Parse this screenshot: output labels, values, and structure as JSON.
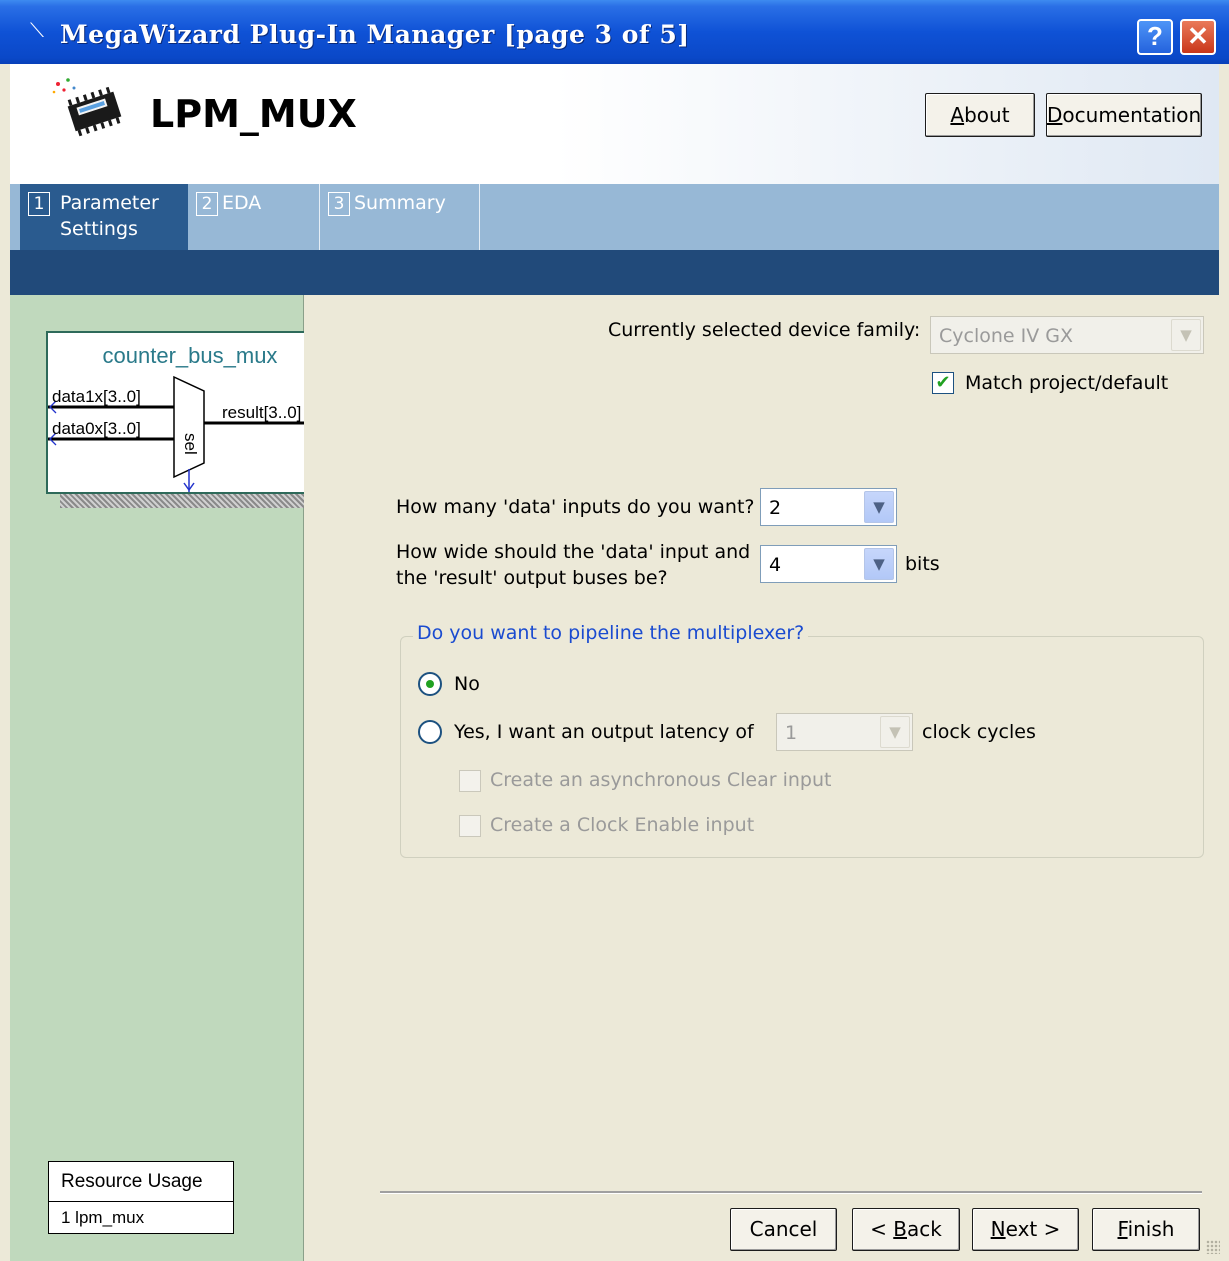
{
  "window": {
    "title": "MegaWizard Plug-In Manager [page 3 of 5]",
    "title_glyph": "⟍",
    "help_glyph": "?",
    "close_glyph": "✕"
  },
  "header": {
    "product_name": "LPM_MUX",
    "about_label": "About",
    "about_mnemonic": "A",
    "doc_label": "Documentation",
    "doc_mnemonic": "D"
  },
  "tabs": [
    {
      "num": "1",
      "label_line1": "Parameter",
      "label_line2": "Settings",
      "active": true
    },
    {
      "num": "2",
      "label_line1": "EDA",
      "label_line2": "",
      "active": false
    },
    {
      "num": "3",
      "label_line1": "Summary",
      "label_line2": "",
      "active": false
    }
  ],
  "symbol": {
    "name": "counter_bus_mux",
    "port_data1": "data1x[3..0]",
    "port_data0": "data0x[3..0]",
    "port_result": "result[3..0]",
    "port_sel": "sel"
  },
  "resource": {
    "header": "Resource Usage",
    "row": "1 lpm_mux"
  },
  "device": {
    "label": "Currently selected device family:",
    "value": "Cyclone IV GX",
    "match_label": "Match project/default",
    "match_checked": true
  },
  "inputs": {
    "count_label": "How many 'data' inputs do you want?",
    "count_value": "2",
    "width_label_1": "How wide should the 'data' input and",
    "width_label_2": "the 'result' output buses be?",
    "width_value": "4",
    "width_unit": "bits"
  },
  "pipeline": {
    "group_title": "Do you want to pipeline the multiplexer?",
    "no_label": "No",
    "yes_label": "Yes, I want an output latency of",
    "latency_value": "1",
    "latency_unit": "clock cycles",
    "async_clear_label": "Create an asynchronous Clear input",
    "clock_enable_label": "Create a Clock Enable input",
    "selected": "No"
  },
  "buttons": {
    "cancel": "Cancel",
    "back_prefix": "< ",
    "back_mn": "B",
    "back_rest": "ack",
    "next_mn": "N",
    "next_rest": "ext >",
    "finish_mn": "F",
    "finish_rest": "inish"
  },
  "colors": {
    "titlebar": "#0f52d6",
    "tab_active": "#2a5b8f",
    "left_panel": "#c0d9bd",
    "group_title": "#1a4bd0"
  }
}
